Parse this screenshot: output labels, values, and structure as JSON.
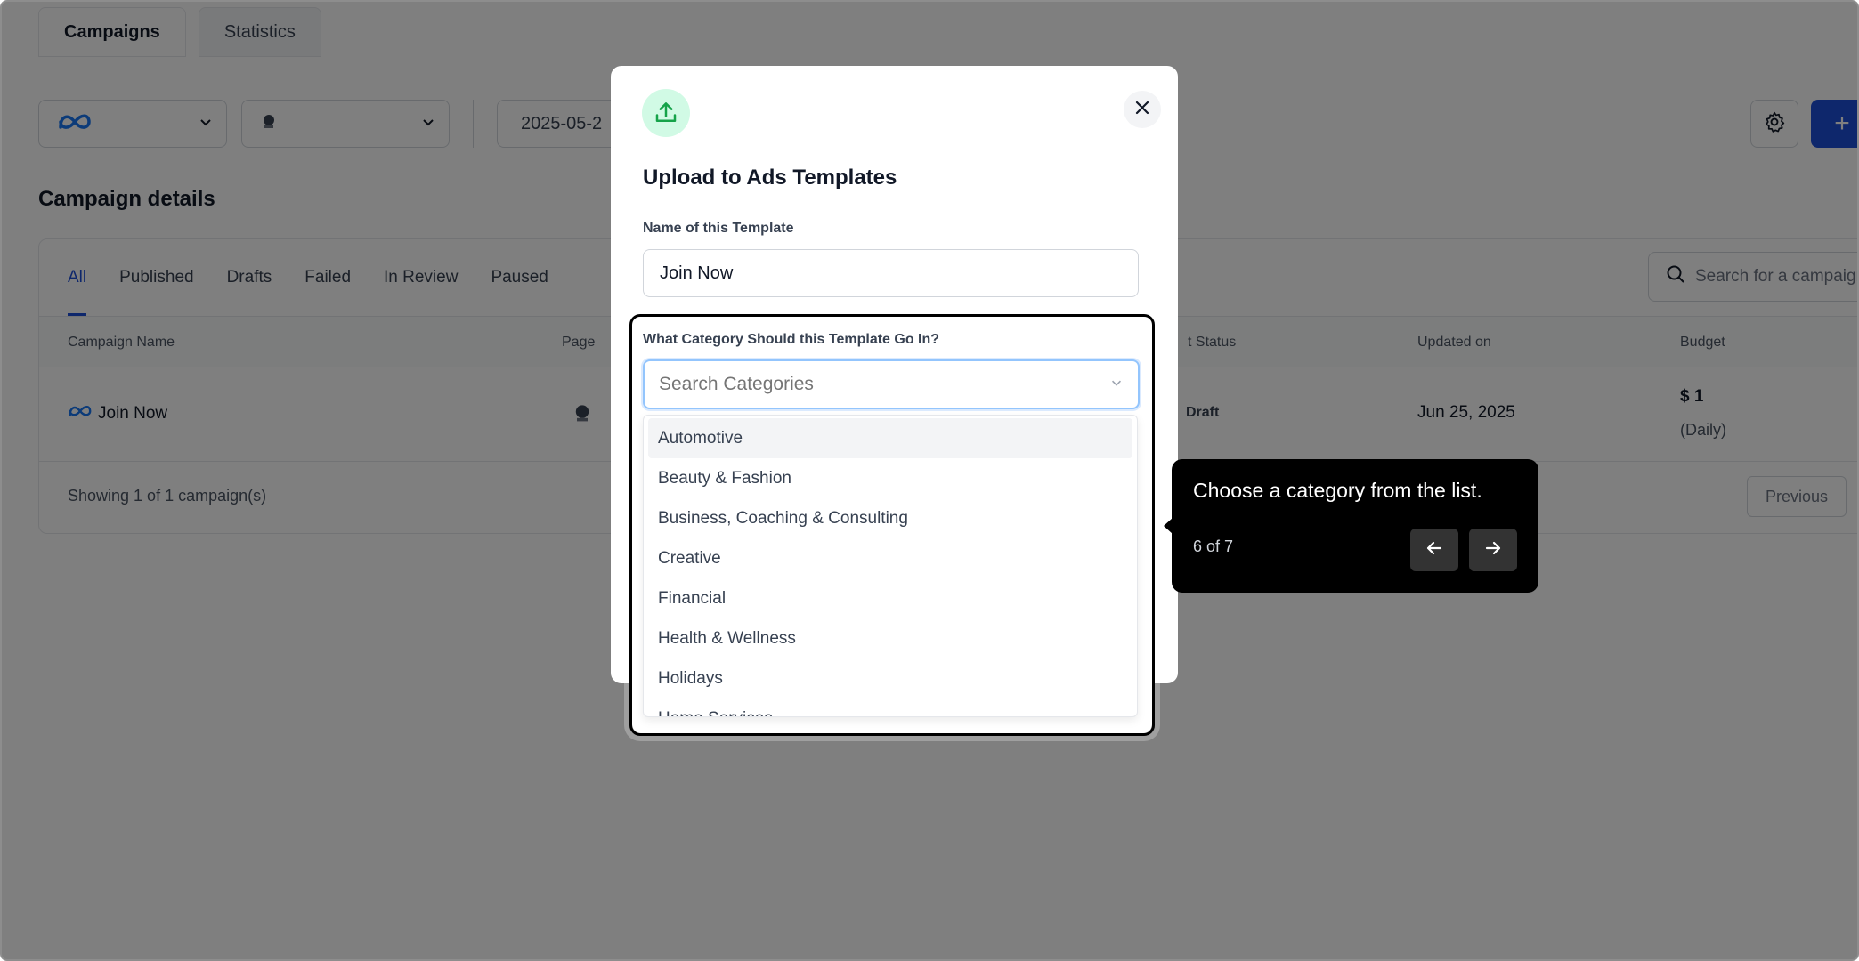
{
  "top_tabs": [
    {
      "label": "Campaigns",
      "active": true
    },
    {
      "label": "Statistics",
      "active": false
    }
  ],
  "filters": {
    "date_value": "2025-05-2"
  },
  "section_title": "Campaign details",
  "status_tabs": [
    "All",
    "Published",
    "Drafts",
    "Failed",
    "In Review",
    "Paused"
  ],
  "search": {
    "placeholder": "Search for a campaign"
  },
  "table": {
    "headers": {
      "campaign_name": "Campaign Name",
      "page": "Page",
      "status": "t Status",
      "updated_on": "Updated on",
      "budget": "Budget"
    },
    "rows": [
      {
        "campaign_name": "Join Now",
        "status": "Draft",
        "updated_on": "Jun 25, 2025",
        "budget": "$ 1",
        "budget_period": "(Daily)"
      }
    ]
  },
  "footer": {
    "showing": "Showing 1 of 1 campaign(s)",
    "previous": "Previous"
  },
  "modal": {
    "title": "Upload to Ads Templates",
    "name_label": "Name of this Template",
    "name_value": "Join Now",
    "category_label": "What Category Should this Template Go In?",
    "category_placeholder": "Search Categories",
    "categories": [
      "Automotive",
      "Beauty & Fashion",
      "Business, Coaching & Consulting",
      "Creative",
      "Financial",
      "Health & Wellness",
      "Holidays",
      "Home Services"
    ]
  },
  "tooltip": {
    "text": "Choose a category from the list.",
    "step": "6 of 7"
  },
  "colors": {
    "accent": "#1d4ed8",
    "success_bg": "#d1fae5",
    "success_icon": "#16a34a",
    "tooltip_bg": "#000000"
  }
}
